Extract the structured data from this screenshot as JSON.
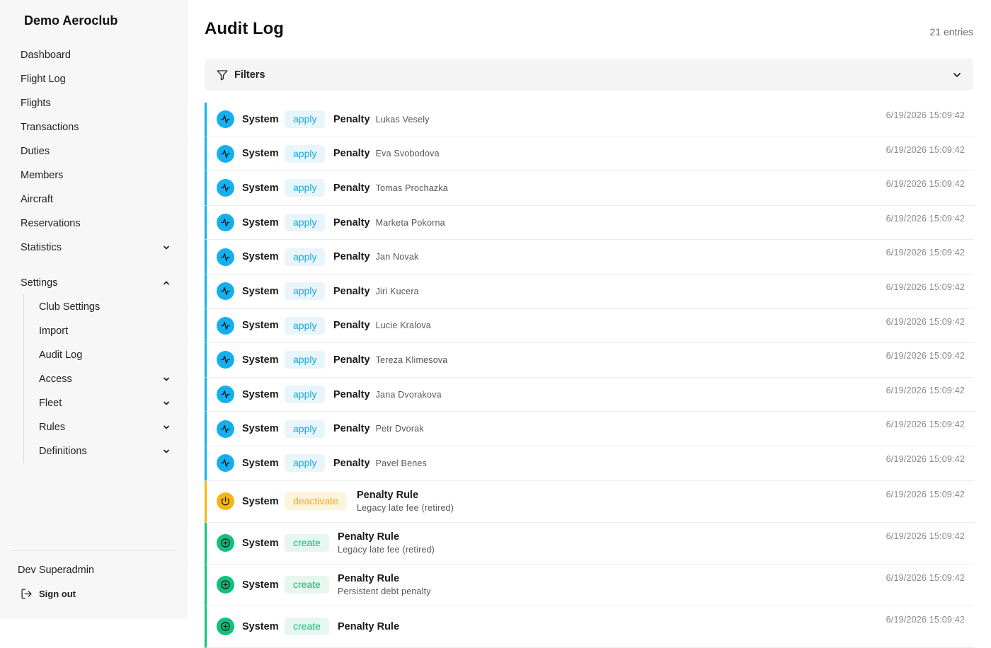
{
  "sidebar": {
    "brand": "Demo Aeroclub",
    "nav": [
      "Dashboard",
      "Flight Log",
      "Flights",
      "Transactions",
      "Duties",
      "Members",
      "Aircraft",
      "Reservations"
    ],
    "statistics": "Statistics",
    "settings": "Settings",
    "settings_sub": [
      "Club Settings",
      "Import",
      "Audit Log"
    ],
    "settings_sub_expandable": [
      "Access",
      "Fleet",
      "Rules",
      "Definitions"
    ],
    "user": "Dev Superadmin",
    "sign_out": "Sign out"
  },
  "header": {
    "title": "Audit Log",
    "entries": "21 entries"
  },
  "filters": {
    "label": "Filters"
  },
  "colors": {
    "apply": "#13b1ea",
    "deactivate": "#f7b511",
    "create": "#10c47e"
  },
  "rows": [
    {
      "actor": "System",
      "action": "apply",
      "type": "Penalty",
      "name": "Lukas Vesely",
      "time": "6/19/2026 15:09:42",
      "icon": "activity-icon"
    },
    {
      "actor": "System",
      "action": "apply",
      "type": "Penalty",
      "name": "Eva Svobodova",
      "time": "6/19/2026 15:09:42",
      "icon": "activity-icon"
    },
    {
      "actor": "System",
      "action": "apply",
      "type": "Penalty",
      "name": "Tomas Prochazka",
      "time": "6/19/2026 15:09:42",
      "icon": "activity-icon"
    },
    {
      "actor": "System",
      "action": "apply",
      "type": "Penalty",
      "name": "Marketa Pokorna",
      "time": "6/19/2026 15:09:42",
      "icon": "activity-icon"
    },
    {
      "actor": "System",
      "action": "apply",
      "type": "Penalty",
      "name": "Jan Novak",
      "time": "6/19/2026 15:09:42",
      "icon": "activity-icon"
    },
    {
      "actor": "System",
      "action": "apply",
      "type": "Penalty",
      "name": "Jiri Kucera",
      "time": "6/19/2026 15:09:42",
      "icon": "activity-icon"
    },
    {
      "actor": "System",
      "action": "apply",
      "type": "Penalty",
      "name": "Lucie Kralova",
      "time": "6/19/2026 15:09:42",
      "icon": "activity-icon"
    },
    {
      "actor": "System",
      "action": "apply",
      "type": "Penalty",
      "name": "Tereza Klimesova",
      "time": "6/19/2026 15:09:42",
      "icon": "activity-icon"
    },
    {
      "actor": "System",
      "action": "apply",
      "type": "Penalty",
      "name": "Jana Dvorakova",
      "time": "6/19/2026 15:09:42",
      "icon": "activity-icon"
    },
    {
      "actor": "System",
      "action": "apply",
      "type": "Penalty",
      "name": "Petr Dvorak",
      "time": "6/19/2026 15:09:42",
      "icon": "activity-icon"
    },
    {
      "actor": "System",
      "action": "apply",
      "type": "Penalty",
      "name": "Pavel Benes",
      "time": "6/19/2026 15:09:42",
      "icon": "activity-icon"
    },
    {
      "actor": "System",
      "action": "deactivate",
      "type": "Penalty Rule",
      "name": "Legacy late fee (retired)",
      "time": "6/19/2026 15:09:42",
      "icon": "power-icon"
    },
    {
      "actor": "System",
      "action": "create",
      "type": "Penalty Rule",
      "name": "Legacy late fee (retired)",
      "time": "6/19/2026 15:09:42",
      "icon": "plus-circle-icon"
    },
    {
      "actor": "System",
      "action": "create",
      "type": "Penalty Rule",
      "name": "Persistent debt penalty",
      "time": "6/19/2026 15:09:42",
      "icon": "plus-circle-icon"
    },
    {
      "actor": "System",
      "action": "create",
      "type": "Penalty Rule",
      "name": "",
      "time": "6/19/2026 15:09:42",
      "icon": "plus-circle-icon"
    }
  ]
}
